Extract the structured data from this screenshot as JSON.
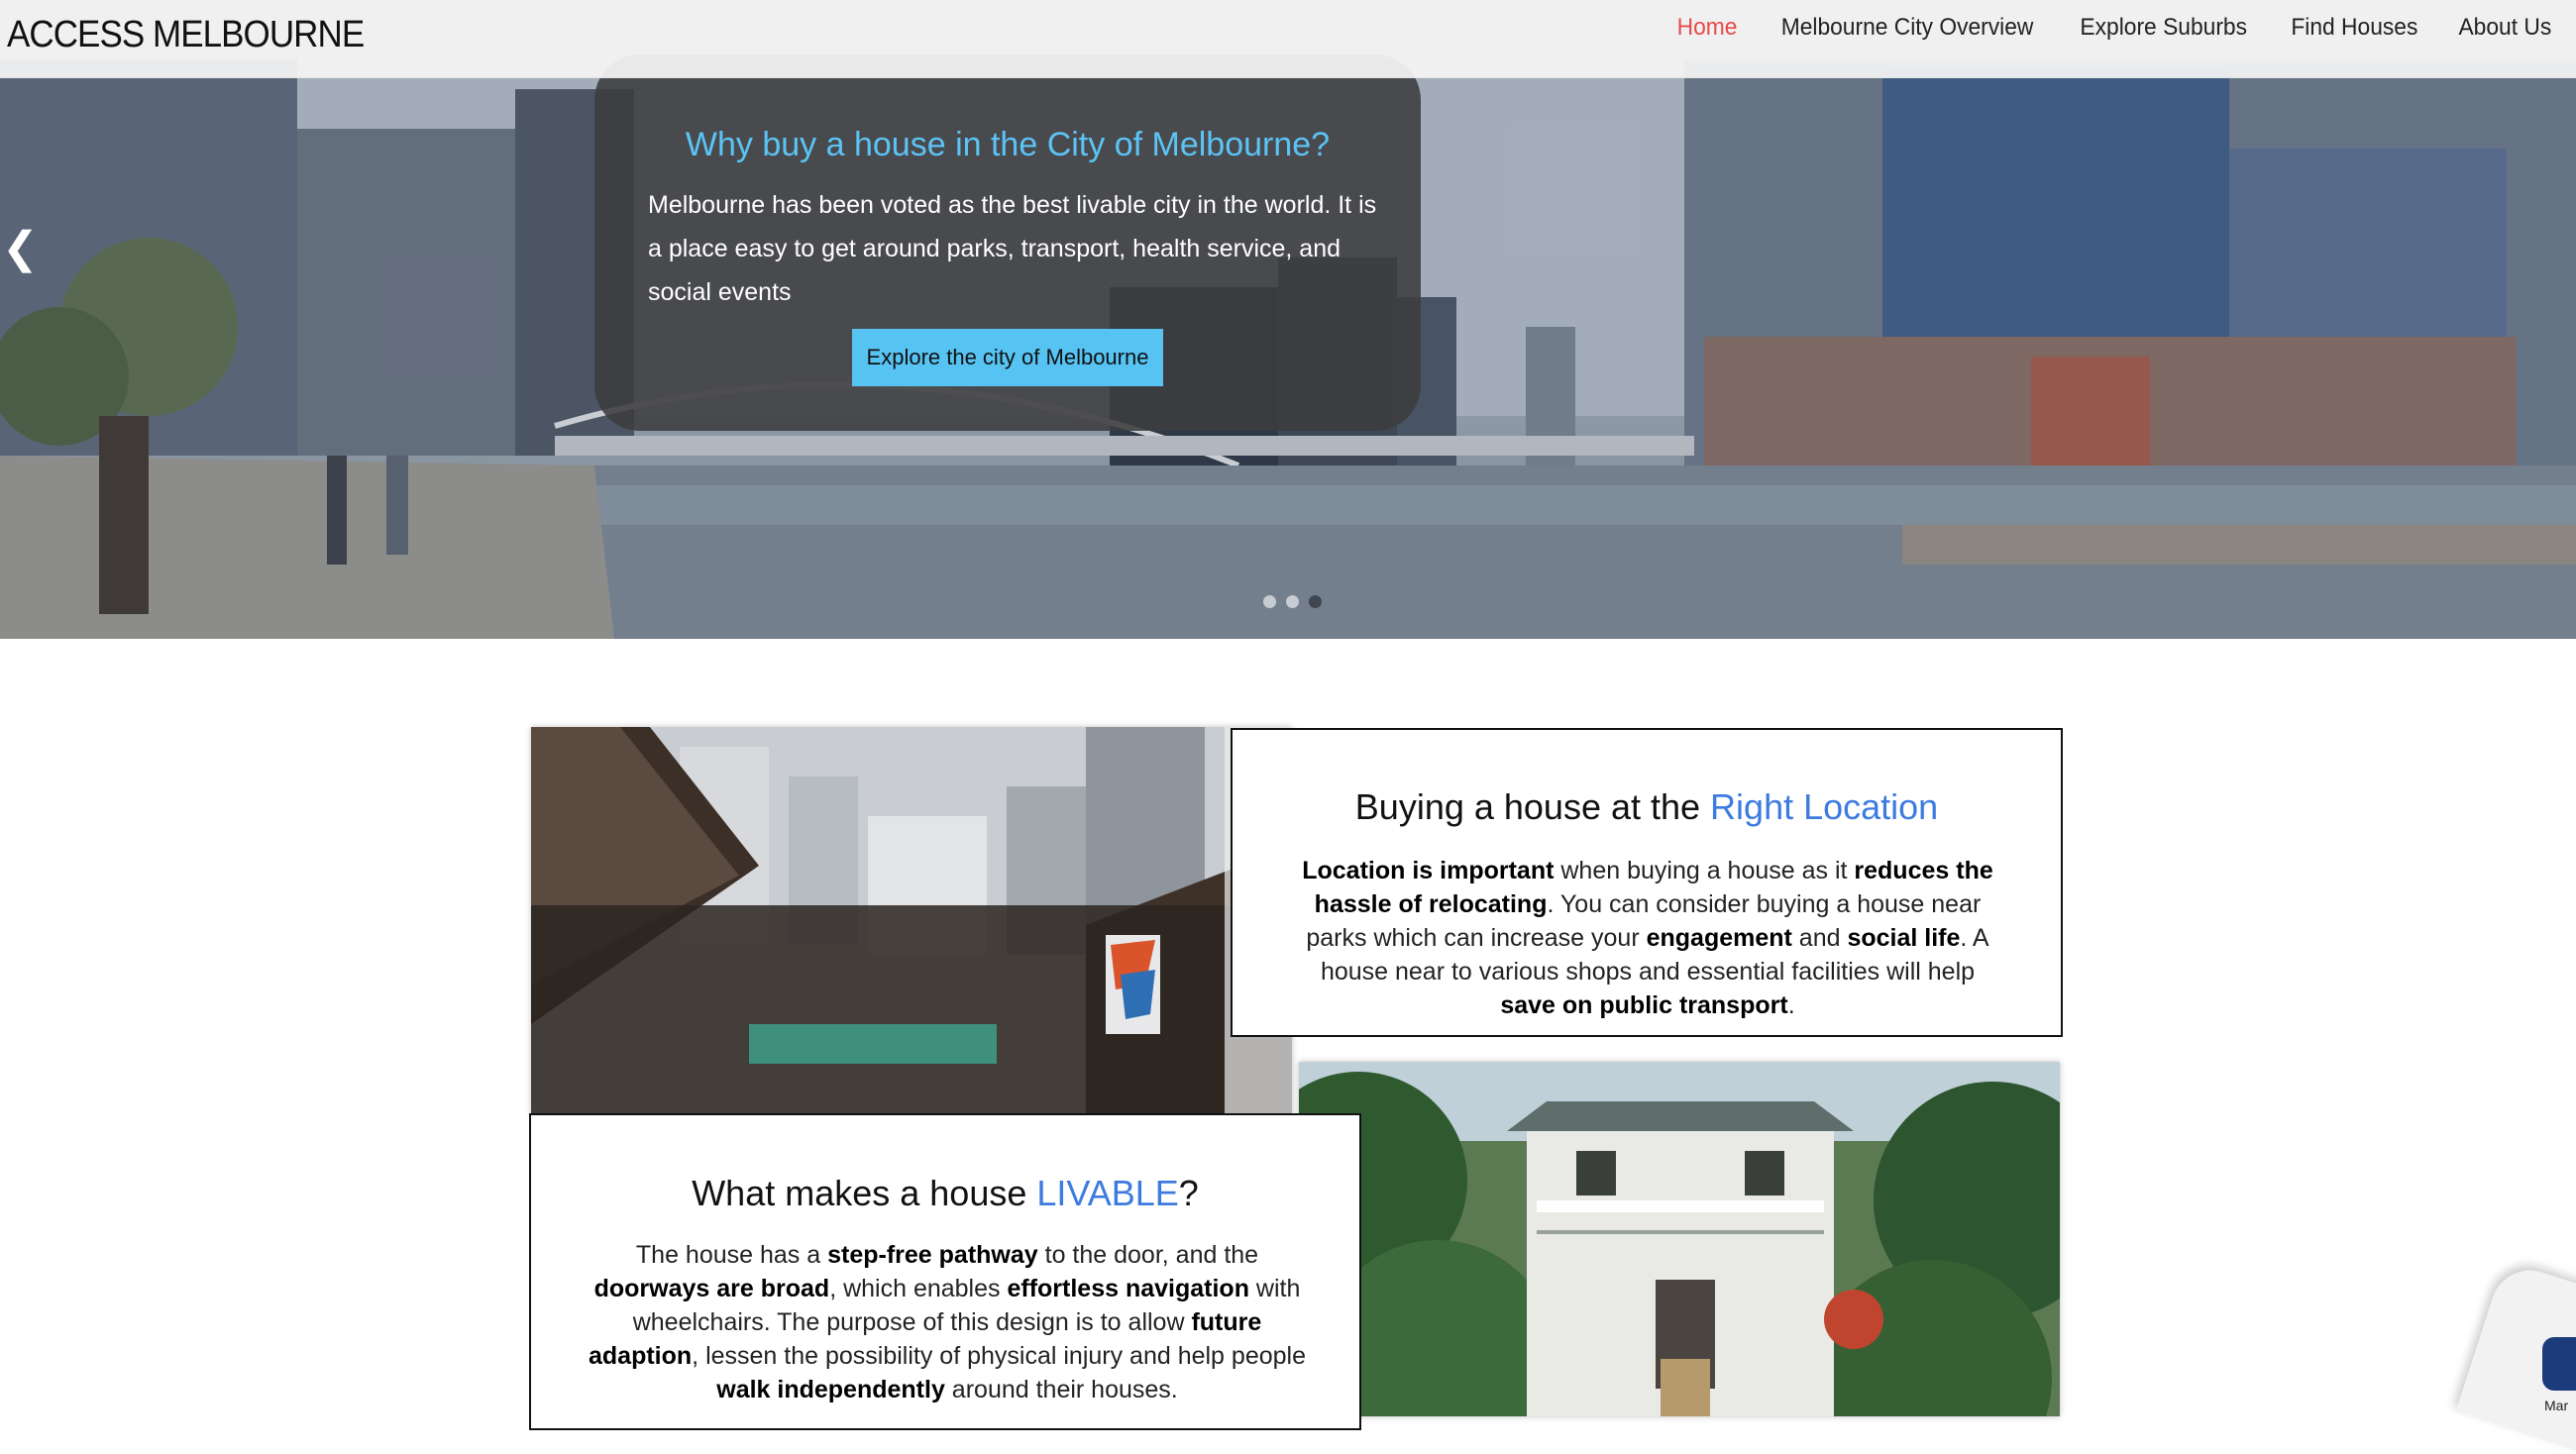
{
  "nav": {
    "brand": "ACCESS MELBOURNE",
    "items": [
      {
        "label": "Home",
        "active": true
      },
      {
        "label": "Melbourne City Overview",
        "active": false
      },
      {
        "label": "Explore Suburbs",
        "active": false
      },
      {
        "label": "Find Houses",
        "active": false
      },
      {
        "label": "About Us",
        "active": false
      }
    ]
  },
  "hero": {
    "title": "Why buy a house in the City of Melbourne?",
    "text": "Melbourne has been voted as the best livable city in the world. It is a place easy to get around parks, transport, health service, and social events",
    "button": "Explore the city of Melbourne",
    "slides_total": 3,
    "active_slide": 3,
    "prev_icon": "chevron-left-icon"
  },
  "location_section": {
    "title_plain": "Buying a house at the ",
    "title_accent": "Right Location",
    "body": [
      {
        "t": "Location is important",
        "b": true
      },
      {
        "t": " when buying a house as it ",
        "b": false
      },
      {
        "t": "reduces the hassle of relocating",
        "b": true
      },
      {
        "t": ".  You can consider buying a house near parks which can increase your ",
        "b": false
      },
      {
        "t": "engagement",
        "b": true
      },
      {
        "t": " and ",
        "b": false
      },
      {
        "t": "social life",
        "b": true
      },
      {
        "t": ". A house near to various shops and essential facilities will help ",
        "b": false
      },
      {
        "t": "save on public transport",
        "b": true
      },
      {
        "t": ".",
        "b": false
      }
    ]
  },
  "livable_section": {
    "title_plain": "What makes a house ",
    "title_accent": "LIVABLE",
    "title_end": "?",
    "body": [
      {
        "t": "The house has a ",
        "b": false
      },
      {
        "t": "step-free pathway",
        "b": true
      },
      {
        "t": " to the door, and the ",
        "b": false
      },
      {
        "t": "doorways are broad",
        "b": true
      },
      {
        "t": ", which enables ",
        "b": false
      },
      {
        "t": "effortless navigation",
        "b": true
      },
      {
        "t": " with wheelchairs. The purpose of this design is to allow ",
        "b": false
      },
      {
        "t": "future adaption",
        "b": true
      },
      {
        "t": ", lessen the possibility of physical injury and help people ",
        "b": false
      },
      {
        "t": "walk independently",
        "b": true
      },
      {
        "t": " around their houses.",
        "b": false
      }
    ]
  },
  "corner_widget": {
    "label": "Mar"
  },
  "colors": {
    "accent_blue": "#3d7be0",
    "hero_title": "#5bc4f5",
    "button": "#56c3f3",
    "nav_active": "#e84a4a"
  }
}
